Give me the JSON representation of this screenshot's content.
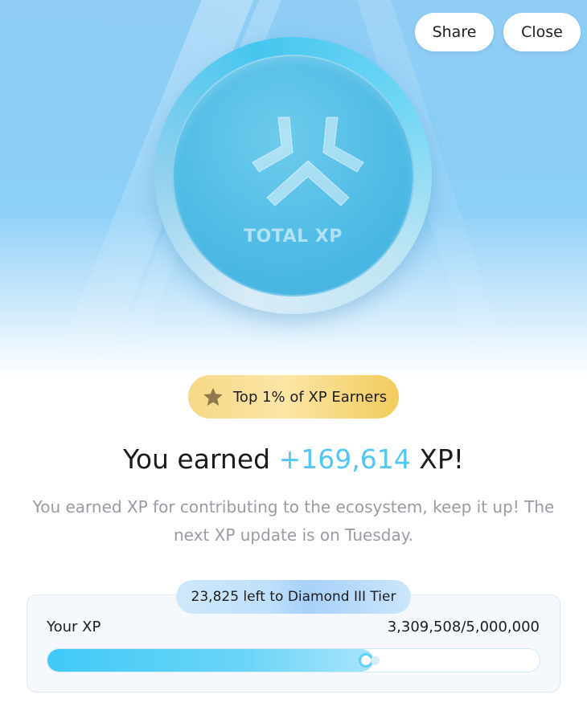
{
  "header": {
    "share_label": "Share",
    "close_label": "Close"
  },
  "coin": {
    "label": "TOTAL XP",
    "icon": "xp-logo-icon"
  },
  "badge": {
    "icon": "star-icon",
    "text": "Top 1% of XP Earners"
  },
  "headline": {
    "prefix": "You earned ",
    "amount": "+169,614",
    "suffix": " XP!"
  },
  "subtext": "You earned XP for contributing to the ecosystem, keep it up! The next XP update is on Tuesday.",
  "progress_card": {
    "tier_note": "23,825 left to Diamond III Tier",
    "label": "Your XP",
    "value_text": "3,309,508/5,000,000",
    "current": 3309508,
    "max": 5000000
  },
  "colors": {
    "accent": "#4fc6f3",
    "badge_gold": "#f2cb5c",
    "subtext_gray": "#9a9ca3"
  }
}
